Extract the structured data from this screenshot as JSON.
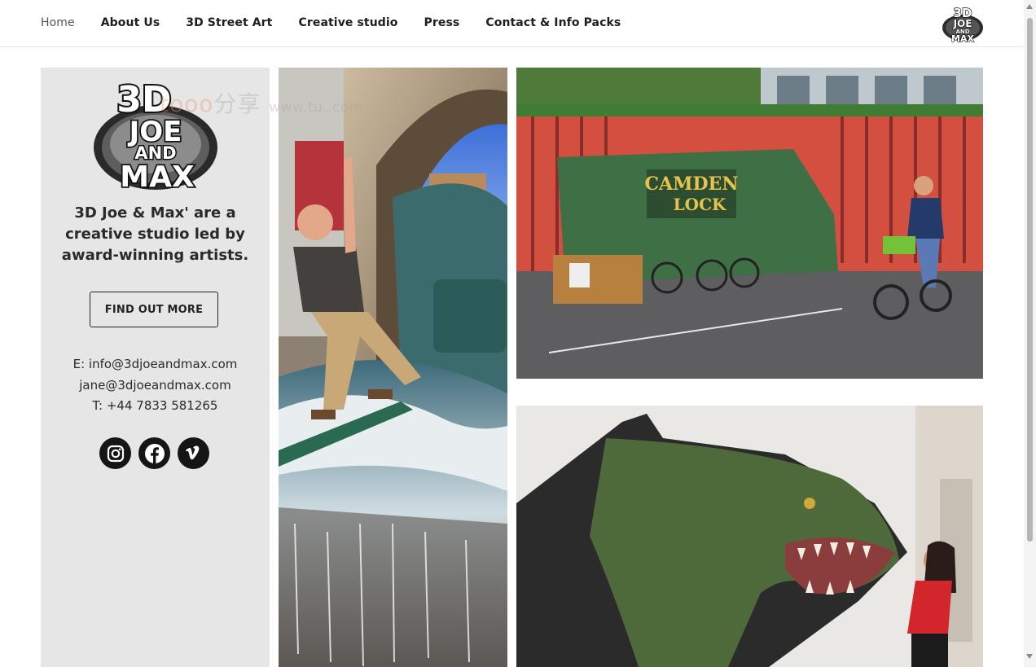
{
  "nav": {
    "items": [
      {
        "label": "Home",
        "active": true
      },
      {
        "label": "About Us"
      },
      {
        "label": "3D Street Art"
      },
      {
        "label": "Creative studio"
      },
      {
        "label": "Press"
      },
      {
        "label": "Contact & Info Packs"
      }
    ]
  },
  "brand": {
    "logo_lines": [
      "3D",
      "JOE",
      "AND",
      "MAX"
    ]
  },
  "info": {
    "tagline": "3D Joe & Max' are a creative studio led by award-winning artists.",
    "cta_label": "FIND OUT MORE",
    "email_1": "E: info@3djoeandmax.com",
    "email_2": "jane@3djoeandmax.com",
    "phone": "T: +44 7833 581265",
    "socials": [
      "instagram-icon",
      "facebook-icon",
      "vimeo-icon"
    ]
  },
  "photos": {
    "camden_sign_line1": "CAMDEN",
    "camden_sign_line2": "LOCK"
  },
  "watermark": {
    "brand": "tooo",
    "cn": "分享",
    "url": "www.tu..com"
  },
  "colors": {
    "panel_bg": "#e6e6e6",
    "text": "#222222",
    "icon_bg": "#151515"
  }
}
